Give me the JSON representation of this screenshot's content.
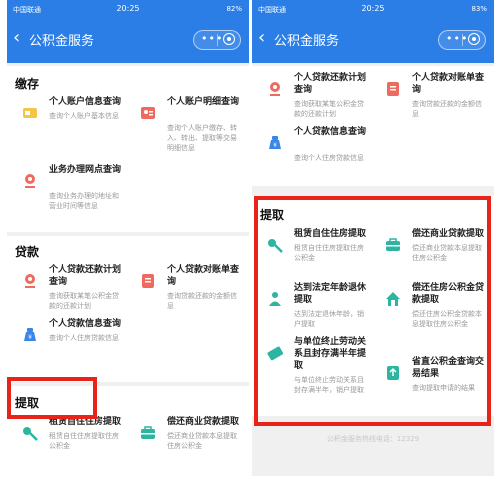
{
  "left": {
    "status": {
      "carrier": "中国联通",
      "time": "20:25",
      "battery": "82%"
    },
    "header": {
      "back": "‹",
      "title": "公积金服务"
    },
    "sections": {
      "deposit": {
        "title": "缴存",
        "items": [
          {
            "title": "个人账户信息查询",
            "desc": "查询个人账户基本信息"
          },
          {
            "title": "个人账户明细查询",
            "desc": "查询个人账户缴存、转入、转出、提取等交易明细信息"
          },
          {
            "title": "业务办理网点查询",
            "desc": "查询业务办理的地址和营业时间等信息"
          }
        ]
      },
      "loan": {
        "title": "贷款",
        "items": [
          {
            "title": "个人贷款还款计划查询",
            "desc": "查询获取某笔公积金贷款的还款计划"
          },
          {
            "title": "个人贷款对账单查询",
            "desc": "查询贷款还款的金额信息"
          },
          {
            "title": "个人贷款信息查询",
            "desc": "查询个人住房贷款信息"
          }
        ]
      },
      "withdraw": {
        "title": "提取",
        "items": [
          {
            "title": "租赁自住住房提取",
            "desc": "租赁自住住房提取住房公积金"
          },
          {
            "title": "偿还商业贷款提取",
            "desc": "偿还商业贷款本息提取住房公积金"
          }
        ]
      }
    }
  },
  "right": {
    "status": {
      "carrier": "中国联通",
      "time": "20:25",
      "battery": "83%"
    },
    "header": {
      "back": "‹",
      "title": "公积金服务"
    },
    "loan_items": [
      {
        "title": "个人贷款还款计划查询",
        "desc": "查询获取某笔公积金贷款的还款计划"
      },
      {
        "title": "个人贷款对账单查询",
        "desc": "查询贷款还款的金额信息"
      },
      {
        "title": "个人贷款信息查询",
        "desc": "查询个人住房贷款信息"
      }
    ],
    "withdraw": {
      "title": "提取",
      "items": [
        {
          "title": "租赁自住住房提取",
          "desc": "租赁自住住房提取住房公积金"
        },
        {
          "title": "偿还商业贷款提取",
          "desc": "偿还商业贷款本息提取住房公积金"
        },
        {
          "title": "达到法定年龄退休提取",
          "desc": "达到法定退休年龄，销户提取"
        },
        {
          "title": "偿还住房公积金贷款提取",
          "desc": "偿还住房公积金贷款本息提取住房公积金"
        },
        {
          "title": "与单位终止劳动关系且封存满半年提取",
          "desc": "与单位终止劳动关系且封存满半年，销户提取"
        },
        {
          "title": "省直公积金查询交易结果",
          "desc": "查询提取申请的结果"
        }
      ]
    },
    "footer": "公积金服务热线电话：12329"
  },
  "colors": {
    "header": "#2a7ee6",
    "highlight": "#e8241a",
    "background": "#f0f0f0"
  }
}
